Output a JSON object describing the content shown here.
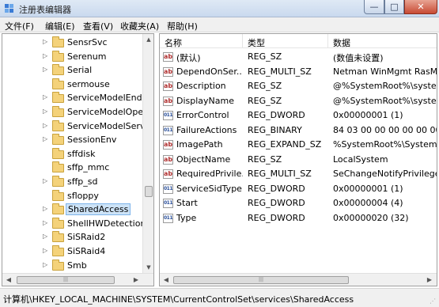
{
  "window": {
    "title": "注册表编辑器",
    "minimize": "—",
    "maximize": "□",
    "close": "✕"
  },
  "menu": [
    "文件(F)",
    "编辑(E)",
    "查看(V)",
    "收藏夹(A)",
    "帮助(H)"
  ],
  "tree": {
    "items": [
      {
        "label": "SensrSvc",
        "expandable": true
      },
      {
        "label": "Serenum",
        "expandable": true
      },
      {
        "label": "Serial",
        "expandable": true
      },
      {
        "label": "sermouse",
        "expandable": false
      },
      {
        "label": "ServiceModelEndp",
        "expandable": true
      },
      {
        "label": "ServiceModelOper",
        "expandable": true
      },
      {
        "label": "ServiceModelServi",
        "expandable": true
      },
      {
        "label": "SessionEnv",
        "expandable": true
      },
      {
        "label": "sffdisk",
        "expandable": false
      },
      {
        "label": "sffp_mmc",
        "expandable": false
      },
      {
        "label": "sffp_sd",
        "expandable": true
      },
      {
        "label": "sfloppy",
        "expandable": false
      },
      {
        "label": "SharedAccess",
        "expandable": true,
        "selected": true
      },
      {
        "label": "ShellHWDetection",
        "expandable": true
      },
      {
        "label": "SiSRaid2",
        "expandable": true
      },
      {
        "label": "SiSRaid4",
        "expandable": true
      },
      {
        "label": "Smb",
        "expandable": true
      }
    ]
  },
  "list": {
    "headers": {
      "name": "名称",
      "type": "类型",
      "data": "数据"
    },
    "rows": [
      {
        "icon": "string-value-icon",
        "name": "(默认)",
        "type": "REG_SZ",
        "data": "(数值未设置)"
      },
      {
        "icon": "string-value-icon",
        "name": "DependOnSer...",
        "type": "REG_MULTI_SZ",
        "data": "Netman WinMgmt RasM"
      },
      {
        "icon": "string-value-icon",
        "name": "Description",
        "type": "REG_SZ",
        "data": "@%SystemRoot%\\system"
      },
      {
        "icon": "string-value-icon",
        "name": "DisplayName",
        "type": "REG_SZ",
        "data": "@%SystemRoot%\\system"
      },
      {
        "icon": "binary-value-icon",
        "name": "ErrorControl",
        "type": "REG_DWORD",
        "data": "0x00000001 (1)"
      },
      {
        "icon": "binary-value-icon",
        "name": "FailureActions",
        "type": "REG_BINARY",
        "data": "84 03 00 00 00 00 00 00"
      },
      {
        "icon": "string-value-icon",
        "name": "ImagePath",
        "type": "REG_EXPAND_SZ",
        "data": "%SystemRoot%\\System3"
      },
      {
        "icon": "string-value-icon",
        "name": "ObjectName",
        "type": "REG_SZ",
        "data": "LocalSystem"
      },
      {
        "icon": "string-value-icon",
        "name": "RequiredPrivile...",
        "type": "REG_MULTI_SZ",
        "data": "SeChangeNotifyPrivilege"
      },
      {
        "icon": "binary-value-icon",
        "name": "ServiceSidType",
        "type": "REG_DWORD",
        "data": "0x00000001 (1)"
      },
      {
        "icon": "binary-value-icon",
        "name": "Start",
        "type": "REG_DWORD",
        "data": "0x00000004 (4)"
      },
      {
        "icon": "binary-value-icon",
        "name": "Type",
        "type": "REG_DWORD",
        "data": "0x00000020 (32)"
      }
    ]
  },
  "statusbar": {
    "path": "计算机\\HKEY_LOCAL_MACHINE\\SYSTEM\\CurrentControlSet\\services\\SharedAccess"
  },
  "colors": {
    "selection": "#cde3f7",
    "folder": "#f4d27a",
    "close_button": "#c74a34"
  }
}
